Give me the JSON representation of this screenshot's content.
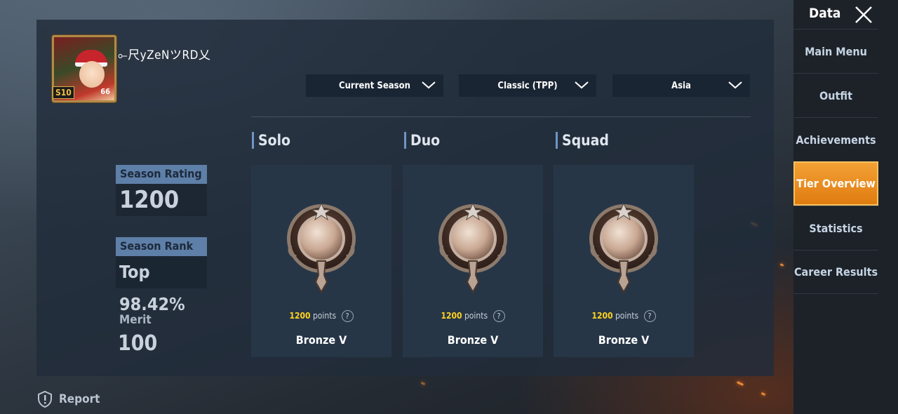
{
  "player": {
    "name": "⟜尺yZeNツRD乂",
    "season_badge": "S10",
    "level": "66"
  },
  "filters": {
    "season": "Current Season",
    "mode": "Classic (TPP)",
    "region": "Asia"
  },
  "stats": {
    "season_rating_label": "Season Rating",
    "season_rating_value": "1200",
    "season_rank_label": "Season Rank",
    "season_rank_value": "Top 98.42%",
    "merit_label": "Merit",
    "merit_value": "100"
  },
  "modes": [
    {
      "title": "Solo",
      "points": "1200",
      "points_label": "points",
      "tier": "Bronze V"
    },
    {
      "title": "Duo",
      "points": "1200",
      "points_label": "points",
      "tier": "Bronze V"
    },
    {
      "title": "Squad",
      "points": "1200",
      "points_label": "points",
      "tier": "Bronze V"
    }
  ],
  "help_glyph": "?",
  "sidebar": {
    "title": "Data",
    "items": [
      {
        "label": "Main Menu",
        "active": false
      },
      {
        "label": "Outfit",
        "active": false
      },
      {
        "label": "Achievements",
        "active": false
      },
      {
        "label": "Tier Overview",
        "active": true
      },
      {
        "label": "Statistics",
        "active": false
      },
      {
        "label": "Career Results",
        "active": false
      }
    ]
  },
  "footer": {
    "report_label": "Report"
  },
  "colors": {
    "accent": "#f2a035",
    "points": "#ffd21f",
    "label_bg": "#5e7fa8"
  }
}
